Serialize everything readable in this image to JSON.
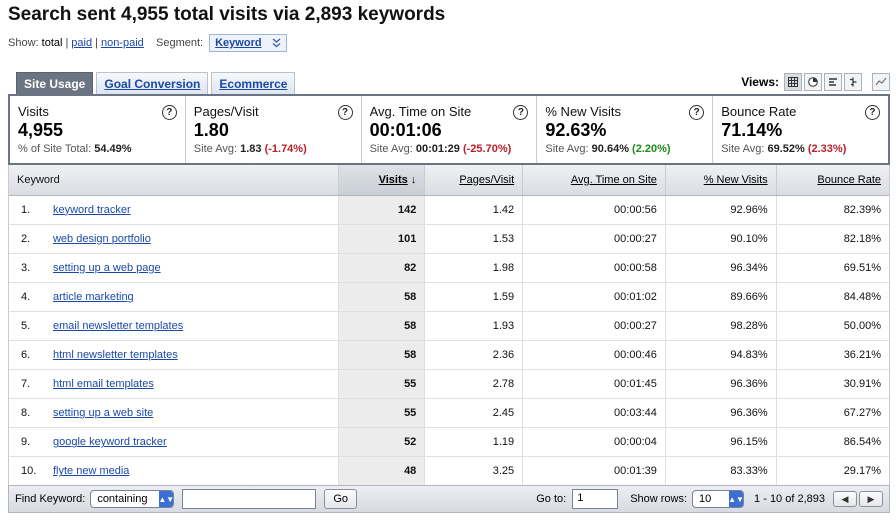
{
  "title": "Search sent 4,955 total visits via 2,893 keywords",
  "show": {
    "label": "Show:",
    "options": [
      "total",
      "paid",
      "non-paid"
    ],
    "selected": "total",
    "segment_label": "Segment:",
    "segment_value": "Keyword"
  },
  "tabs": [
    {
      "label": "Site Usage",
      "active": true
    },
    {
      "label": "Goal Conversion",
      "active": false
    },
    {
      "label": "Ecommerce",
      "active": false
    }
  ],
  "views": {
    "label": "Views:",
    "icons": [
      "table-view-icon",
      "pie-view-icon",
      "performance-view-icon",
      "comparison-view-icon",
      "pivot-view-icon"
    ]
  },
  "scorecard": [
    {
      "name": "Visits",
      "value": "4,955",
      "sub_label": "% of Site Total:",
      "sub_value": "54.49%",
      "delta": "",
      "delta_type": ""
    },
    {
      "name": "Pages/Visit",
      "value": "1.80",
      "sub_label": "Site Avg:",
      "sub_value": "1.83",
      "delta": "(-1.74%)",
      "delta_type": "neg"
    },
    {
      "name": "Avg. Time on Site",
      "value": "00:01:06",
      "sub_label": "Site Avg:",
      "sub_value": "00:01:29",
      "delta": "(-25.70%)",
      "delta_type": "neg"
    },
    {
      "name": "% New Visits",
      "value": "92.63%",
      "sub_label": "Site Avg:",
      "sub_value": "90.64%",
      "delta": "(2.20%)",
      "delta_type": "pos"
    },
    {
      "name": "Bounce Rate",
      "value": "71.14%",
      "sub_label": "Site Avg:",
      "sub_value": "69.52%",
      "delta": "(2.33%)",
      "delta_type": "neg"
    }
  ],
  "table": {
    "columns": [
      "Keyword",
      "Visits",
      "Pages/Visit",
      "Avg. Time on Site",
      "% New Visits",
      "Bounce Rate"
    ],
    "rows": [
      {
        "idx": "1.",
        "keyword": "keyword tracker",
        "visits": "142",
        "pv": "1.42",
        "time": "00:00:56",
        "new": "92.96%",
        "bounce": "82.39%"
      },
      {
        "idx": "2.",
        "keyword": "web design portfolio",
        "visits": "101",
        "pv": "1.53",
        "time": "00:00:27",
        "new": "90.10%",
        "bounce": "82.18%"
      },
      {
        "idx": "3.",
        "keyword": "setting up a web page",
        "visits": "82",
        "pv": "1.98",
        "time": "00:00:58",
        "new": "96.34%",
        "bounce": "69.51%"
      },
      {
        "idx": "4.",
        "keyword": "article marketing",
        "visits": "58",
        "pv": "1.59",
        "time": "00:01:02",
        "new": "89.66%",
        "bounce": "84.48%"
      },
      {
        "idx": "5.",
        "keyword": "email newsletter templates",
        "visits": "58",
        "pv": "1.93",
        "time": "00:00:27",
        "new": "98.28%",
        "bounce": "50.00%"
      },
      {
        "idx": "6.",
        "keyword": "html newsletter templates",
        "visits": "58",
        "pv": "2.36",
        "time": "00:00:46",
        "new": "94.83%",
        "bounce": "36.21%"
      },
      {
        "idx": "7.",
        "keyword": "html email templates",
        "visits": "55",
        "pv": "2.78",
        "time": "00:01:45",
        "new": "96.36%",
        "bounce": "30.91%"
      },
      {
        "idx": "8.",
        "keyword": "setting up a web site",
        "visits": "55",
        "pv": "2.45",
        "time": "00:03:44",
        "new": "96.36%",
        "bounce": "67.27%"
      },
      {
        "idx": "9.",
        "keyword": "google keyword tracker",
        "visits": "52",
        "pv": "1.19",
        "time": "00:00:04",
        "new": "96.15%",
        "bounce": "86.54%"
      },
      {
        "idx": "10.",
        "keyword": "flyte new media",
        "visits": "48",
        "pv": "3.25",
        "time": "00:01:39",
        "new": "83.33%",
        "bounce": "29.17%"
      }
    ]
  },
  "footer": {
    "find_label": "Find Keyword:",
    "match_value": "containing",
    "search_value": "",
    "go_label": "Go",
    "goto_label": "Go to:",
    "goto_value": "1",
    "showrows_label": "Show rows:",
    "showrows_value": "10",
    "range": "1 - 10 of 2,893"
  }
}
